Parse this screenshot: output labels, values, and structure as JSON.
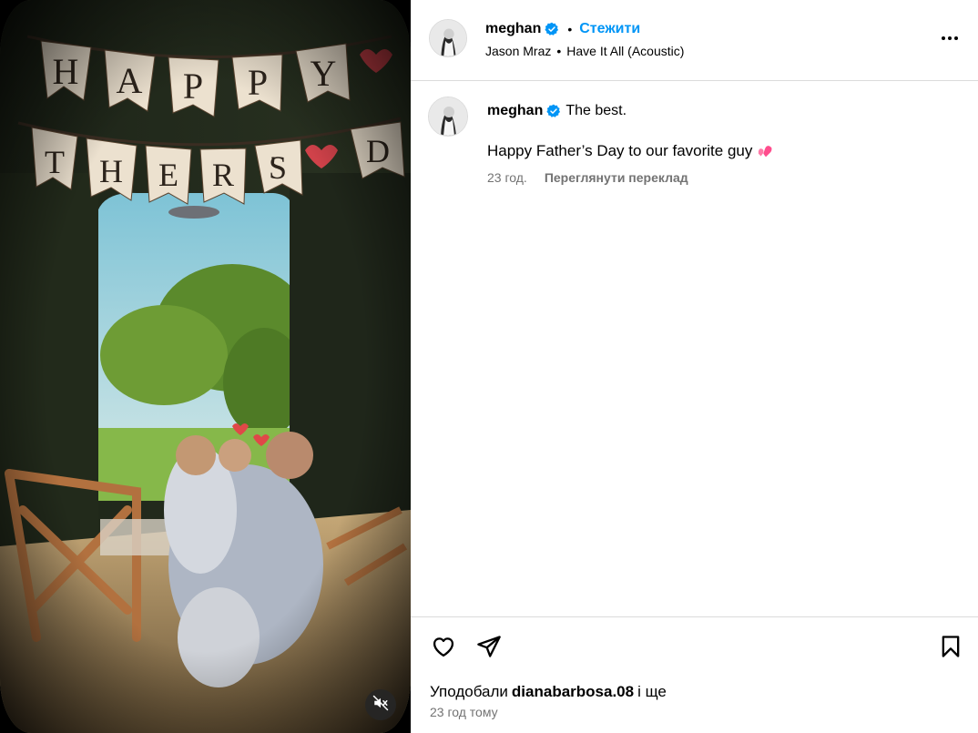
{
  "post": {
    "author": "meghan",
    "follow_label": "Стежити",
    "separator": "•",
    "music": {
      "artist": "Jason Mraz",
      "separator": "•",
      "track": "Have It All (Acoustic)"
    },
    "more_icon": "more-horizontal-icon"
  },
  "caption": {
    "author": "meghan",
    "headline": "The best.",
    "body": "Happy Father’s Day to our favorite guy",
    "emoji": "two-hearts-emoji",
    "time": "23 год.",
    "translate_label": "Переглянути переклад"
  },
  "media": {
    "banner_letters_top": [
      "H",
      "A",
      "P",
      "P",
      "Y"
    ],
    "banner_letters_bottom": [
      "T",
      "H",
      "E",
      "R",
      "'",
      "S",
      "D"
    ],
    "mute_icon": "speaker-muted-icon"
  },
  "actions": {
    "like_icon": "heart-outline-icon",
    "share_icon": "paper-plane-icon",
    "save_icon": "bookmark-outline-icon",
    "likes_prefix": "Уподобали",
    "likes_user": "dianabarbosa.08",
    "likes_suffix": "і ще",
    "time_ago": "23 год тому"
  },
  "colors": {
    "accent": "#0095f6",
    "verified": "#0095f6",
    "secondary_text": "#737373",
    "border": "#dbdbdb",
    "heart_emoji": "#ff4d8d"
  }
}
